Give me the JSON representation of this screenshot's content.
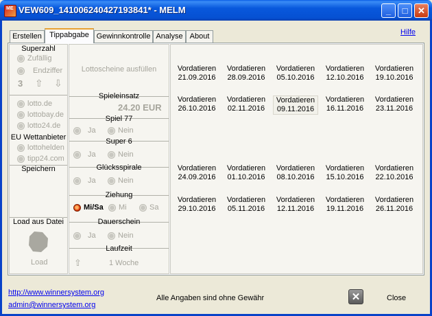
{
  "window": {
    "title": "VEW609_141006240427193841* - MELM",
    "icon_text": "ME",
    "minimize": "_",
    "maximize": "□",
    "close": "✕"
  },
  "tabs": [
    "Erstellen",
    "Tippabgabe",
    "Gewinnkontrolle",
    "Analyse",
    "About"
  ],
  "active_tab": "Tippabgabe",
  "help_link": "Hilfe",
  "left": {
    "superzahl_header": "Superzahl",
    "zufaellig": "Zufällig",
    "endziffer": "Endziffer",
    "endziffer_value": "3",
    "up_arrow": "⇧",
    "down_arrow": "⇩",
    "providers": [
      "lotto.de",
      "lottobay.de",
      "lotto24.de"
    ],
    "eu_header": "EU Wettanbieter",
    "eu_providers": [
      "lottohelden",
      "tipp24.com"
    ],
    "speichern_header": "Speichern",
    "load_header": "Load aus Datei",
    "load_button": "Load"
  },
  "middle": {
    "fill_button": "Lottoscheine ausfüllen",
    "spieleinsatz_header": "Spieleinsatz",
    "spieleinsatz_value": "24.20 EUR",
    "spiel77_header": "Spiel 77",
    "super6_header": "Super 6",
    "gluecksspirale_header": "Glücksspirale",
    "ja": "Ja",
    "nein": "Nein",
    "ziehung_header": "Ziehung",
    "ziehung_options": [
      "Mi/Sa",
      "Mi",
      "Sa"
    ],
    "ziehung_selected": "Mi/Sa",
    "dauerschein_header": "Dauerschein",
    "laufzeit_header": "Laufzeit",
    "laufzeit_value": "1 Woche",
    "laufzeit_arrow": "⇧"
  },
  "grid": {
    "label": "Vordatieren",
    "rows": [
      [
        "21.09.2016",
        "28.09.2016",
        "05.10.2016",
        "12.10.2016",
        "19.10.2016"
      ],
      [
        "26.10.2016",
        "02.11.2016",
        "09.11.2016",
        "16.11.2016",
        "23.11.2016"
      ],
      [
        "24.09.2016",
        "01.10.2016",
        "08.10.2016",
        "15.10.2016",
        "22.10.2016"
      ],
      [
        "29.10.2016",
        "05.11.2016",
        "12.11.2016",
        "19.11.2016",
        "26.11.2016"
      ]
    ]
  },
  "footer": {
    "url": "http://www.winnersystem.org",
    "email": "admin@winnersystem.org",
    "disclaimer": "Alle Angaben sind ohne Gewähr",
    "close_icon": "✕",
    "close_label": "Close"
  },
  "colors": {
    "title_bar": "#0858dc",
    "accent": "#e04010",
    "link": "#0000ee"
  }
}
